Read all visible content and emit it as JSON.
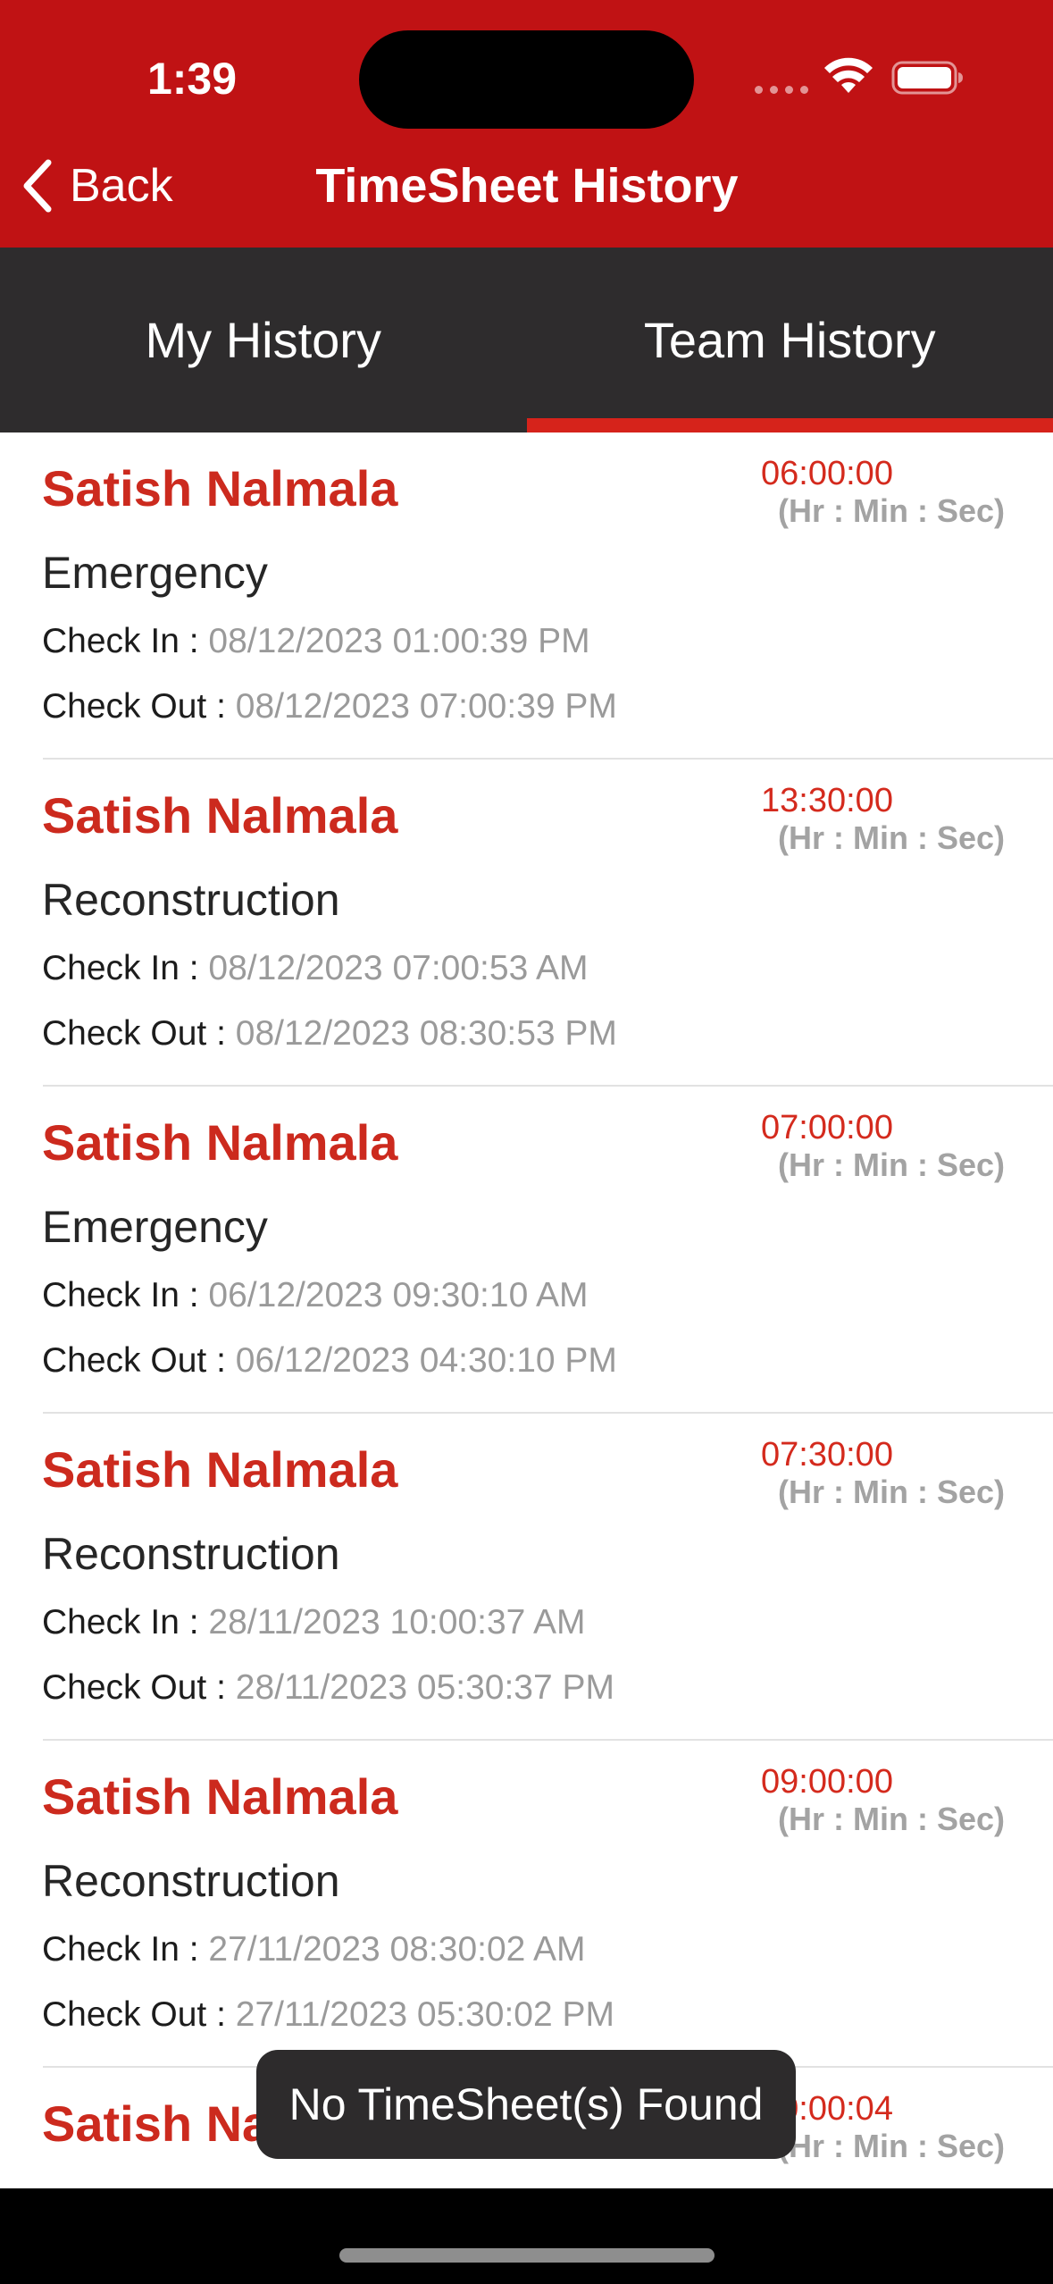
{
  "status_bar": {
    "time": "1:39"
  },
  "nav": {
    "back_label": "Back",
    "title": "TimeSheet History"
  },
  "tabs": [
    {
      "label": "My History",
      "selected": false
    },
    {
      "label": "Team History",
      "selected": true
    }
  ],
  "records": [
    {
      "name": "Satish Nalmala",
      "duration": "06:00:00",
      "unit": "(Hr : Min : Sec)",
      "category": "Emergency",
      "check_in_label": "Check In : ",
      "check_in": "08/12/2023 01:00:39 PM",
      "check_out_label": "Check Out : ",
      "check_out": "08/12/2023 07:00:39 PM"
    },
    {
      "name": "Satish Nalmala",
      "duration": "13:30:00",
      "unit": "(Hr : Min : Sec)",
      "category": "Reconstruction",
      "check_in_label": "Check In : ",
      "check_in": "08/12/2023 07:00:53 AM",
      "check_out_label": "Check Out : ",
      "check_out": "08/12/2023 08:30:53 PM"
    },
    {
      "name": "Satish Nalmala",
      "duration": "07:00:00",
      "unit": "(Hr : Min : Sec)",
      "category": "Emergency",
      "check_in_label": "Check In : ",
      "check_in": "06/12/2023 09:30:10 AM",
      "check_out_label": "Check Out : ",
      "check_out": "06/12/2023 04:30:10 PM"
    },
    {
      "name": "Satish Nalmala",
      "duration": "07:30:00",
      "unit": "(Hr : Min : Sec)",
      "category": "Reconstruction",
      "check_in_label": "Check In : ",
      "check_in": "28/11/2023 10:00:37 AM",
      "check_out_label": "Check Out : ",
      "check_out": "28/11/2023 05:30:37 PM"
    },
    {
      "name": "Satish Nalmala",
      "duration": "09:00:00",
      "unit": "(Hr : Min : Sec)",
      "category": "Reconstruction",
      "check_in_label": "Check In : ",
      "check_in": "27/11/2023 08:30:02 AM",
      "check_out_label": "Check Out : ",
      "check_out": "27/11/2023 05:30:02 PM"
    },
    {
      "name": "Satish Nalmala",
      "duration": "00:00:04",
      "unit": "(Hr : Min : Sec)"
    }
  ],
  "toast": {
    "message": "No TimeSheet(s) Found"
  },
  "colors": {
    "header": "#c01214",
    "tab_bar": "#2e2c2d",
    "tab_indicator": "#d6231b",
    "accent_text": "#cc2a1e",
    "secondary_text": "#9a9a9a"
  },
  "icons": {
    "back": "chevron-left-icon",
    "wifi": "wifi-icon",
    "battery": "battery-icon",
    "signal": "cellular-signal-icon"
  }
}
